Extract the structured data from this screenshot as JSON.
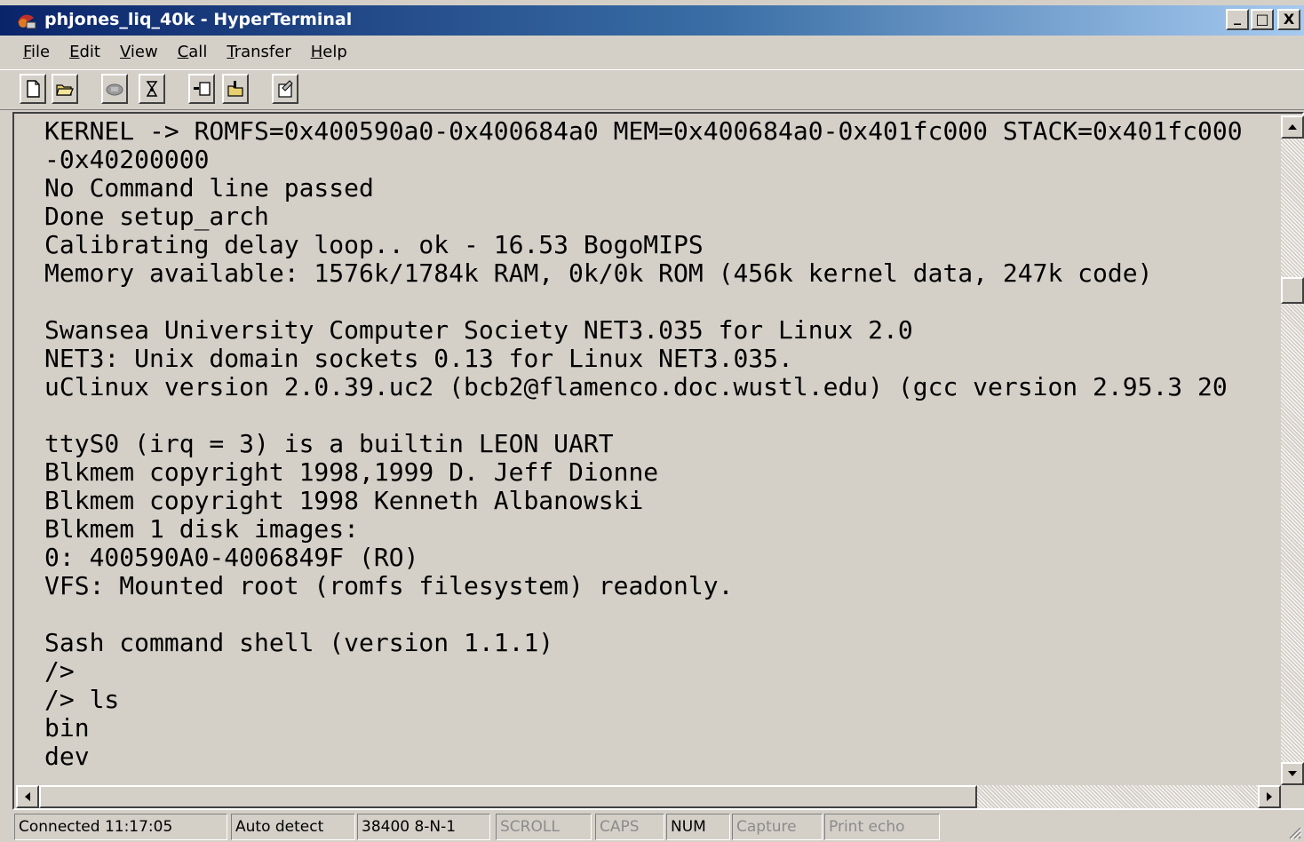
{
  "window": {
    "title": "phjones_liq_40k - HyperTerminal",
    "minimize_label": "_",
    "maximize_label": "□",
    "close_label": "X"
  },
  "menu": {
    "items": [
      {
        "label": "File",
        "accel": "F"
      },
      {
        "label": "Edit",
        "accel": "E"
      },
      {
        "label": "View",
        "accel": "V"
      },
      {
        "label": "Call",
        "accel": "C"
      },
      {
        "label": "Transfer",
        "accel": "T"
      },
      {
        "label": "Help",
        "accel": "H"
      }
    ]
  },
  "toolbar": {
    "buttons": [
      {
        "icon": "new-document-icon"
      },
      {
        "icon": "open-folder-icon"
      },
      {
        "icon": "call-icon"
      },
      {
        "icon": "disconnect-icon"
      },
      {
        "icon": "send-icon"
      },
      {
        "icon": "receive-icon"
      },
      {
        "icon": "properties-icon"
      }
    ]
  },
  "terminal": {
    "lines": [
      "KERNEL -> ROMFS=0x400590a0-0x400684a0 MEM=0x400684a0-0x401fc000 STACK=0x401fc000",
      "-0x40200000",
      "No Command line passed",
      "Done setup_arch",
      "Calibrating delay loop.. ok - 16.53 BogoMIPS",
      "Memory available: 1576k/1784k RAM, 0k/0k ROM (456k kernel data, 247k code)",
      "",
      "Swansea University Computer Society NET3.035 for Linux 2.0",
      "NET3: Unix domain sockets 0.13 for Linux NET3.035.",
      "uClinux version 2.0.39.uc2 (bcb2@flamenco.doc.wustl.edu) (gcc version 2.95.3 20",
      "",
      "ttyS0 (irq = 3) is a builtin LEON UART",
      "Blkmem copyright 1998,1999 D. Jeff Dionne",
      "Blkmem copyright 1998 Kenneth Albanowski",
      "Blkmem 1 disk images:",
      "0: 400590A0-4006849F (RO)",
      "VFS: Mounted root (romfs filesystem) readonly.",
      "",
      "Sash command shell (version 1.1.1)",
      "/>",
      "/> ls",
      "bin",
      "dev"
    ]
  },
  "statusbar": {
    "connected": "Connected 11:17:05",
    "detect": "Auto detect",
    "port": "38400 8-N-1",
    "scroll": "SCROLL",
    "caps": "CAPS",
    "num": "NUM",
    "capture": "Capture",
    "print_echo": "Print echo"
  }
}
